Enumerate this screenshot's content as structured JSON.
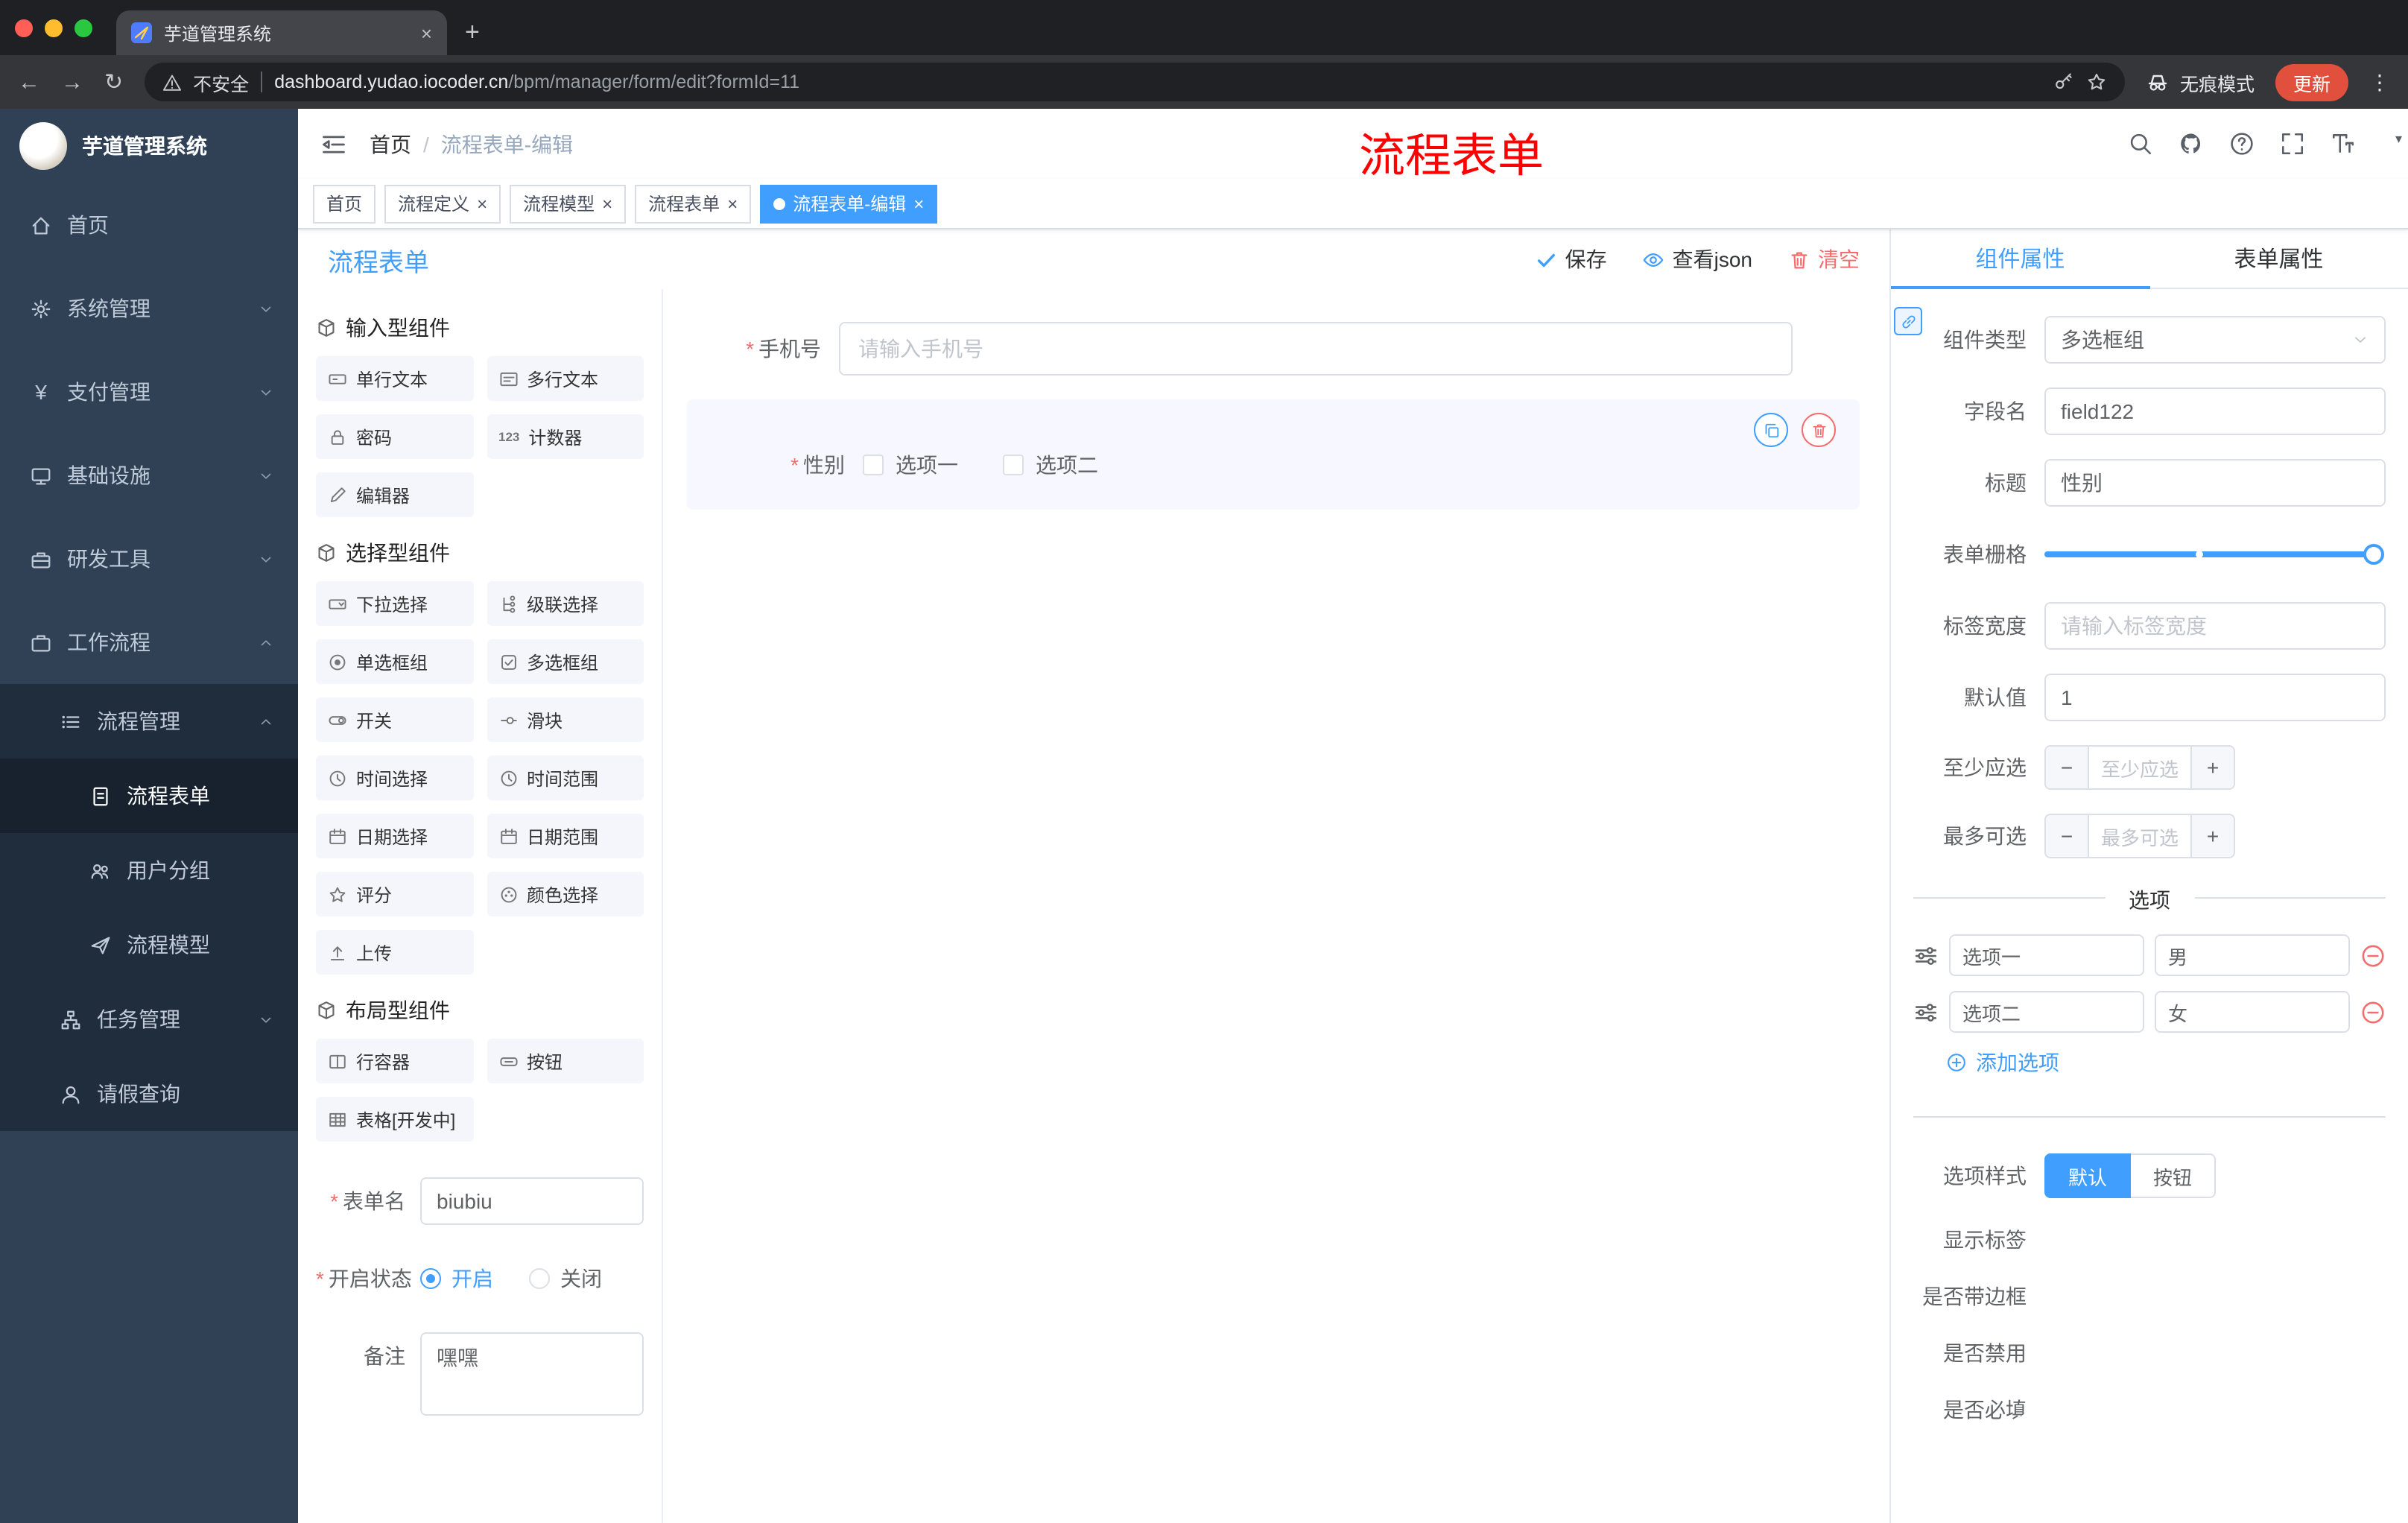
{
  "glyphs": {
    "close": "×",
    "plus": "+",
    "back": "←",
    "forward": "→",
    "reload": "↻",
    "menu_dots": "⋮",
    "minus": "−",
    "plus_sign": "+",
    "counter": "123",
    "caret": "▾"
  },
  "colors": {
    "accent": "#409EFF",
    "danger": "#F56C6C",
    "sidebar_bg": "#304156",
    "submenu_bg": "#1F2D3D",
    "annotation": "#FF0000",
    "update_button": "#E0503C"
  },
  "browser": {
    "tab_title": "芋道管理系统",
    "security_label": "不安全",
    "url_domain": "dashboard.yudao.iocoder.cn",
    "url_path": "/bpm/manager/form/edit?formId=11",
    "incognito_label": "无痕模式",
    "update_label": "更新"
  },
  "sidebar": {
    "logo_title": "芋道管理系统",
    "menu": [
      {
        "label": "首页"
      },
      {
        "label": "系统管理"
      },
      {
        "label": "支付管理"
      },
      {
        "label": "基础设施"
      },
      {
        "label": "研发工具"
      },
      {
        "label": "工作流程"
      },
      {
        "label": "流程管理"
      },
      {
        "label": "流程表单"
      },
      {
        "label": "用户分组"
      },
      {
        "label": "流程模型"
      },
      {
        "label": "任务管理"
      },
      {
        "label": "请假查询"
      }
    ]
  },
  "header": {
    "breadcrumb_home": "首页",
    "breadcrumb_sep": "/",
    "breadcrumb_current": "流程表单-编辑",
    "annotation": "流程表单"
  },
  "tags": [
    {
      "label": "首页"
    },
    {
      "label": "流程定义"
    },
    {
      "label": "流程模型"
    },
    {
      "label": "流程表单"
    },
    {
      "label": "流程表单-编辑"
    }
  ],
  "designer": {
    "title": "流程表单",
    "actions": {
      "save": "保存",
      "view_json": "查看json",
      "clear": "清空"
    },
    "palette": {
      "sections": [
        {
          "title": "输入型组件",
          "items": [
            "单行文本",
            "多行文本",
            "密码",
            "计数器",
            "编辑器"
          ]
        },
        {
          "title": "选择型组件",
          "items": [
            "下拉选择",
            "级联选择",
            "单选框组",
            "多选框组",
            "开关",
            "滑块",
            "时间选择",
            "时间范围",
            "日期选择",
            "日期范围",
            "评分",
            "颜色选择",
            "上传"
          ]
        },
        {
          "title": "布局型组件",
          "items": [
            "行容器",
            "按钮",
            "表格[开发中]"
          ]
        }
      ]
    },
    "meta": {
      "form_name_label": "表单名",
      "form_name_value": "biubiu",
      "status_label": "开启状态",
      "status_on": "开启",
      "status_off": "关闭",
      "remark_label": "备注",
      "remark_value": "嘿嘿"
    },
    "canvas": {
      "phone_label": "手机号",
      "phone_placeholder": "请输入手机号",
      "gender_label": "性别",
      "gender_options": [
        "选项一",
        "选项二"
      ]
    }
  },
  "props": {
    "tab_component": "组件属性",
    "tab_form": "表单属性",
    "component_type_label": "组件类型",
    "component_type_value": "多选框组",
    "field_name_label": "字段名",
    "field_name_value": "field122",
    "title_label": "标题",
    "title_value": "性别",
    "grid_label": "表单栅格",
    "tag_width_label": "标签宽度",
    "tag_width_placeholder": "请输入标签宽度",
    "default_label": "默认值",
    "default_value": "1",
    "min_label": "至少应选",
    "min_placeholder": "至少应选",
    "max_label": "最多可选",
    "max_placeholder": "最多可选",
    "options_divider": "选项",
    "options": [
      {
        "label": "选项一",
        "value": "男"
      },
      {
        "label": "选项二",
        "value": "女"
      }
    ],
    "add_option": "添加选项",
    "style_label": "选项样式",
    "style_default": "默认",
    "style_button": "按钮",
    "show_label": "显示标签",
    "border_label": "是否带边框",
    "disabled_label": "是否禁用",
    "required_label": "是否必填"
  }
}
